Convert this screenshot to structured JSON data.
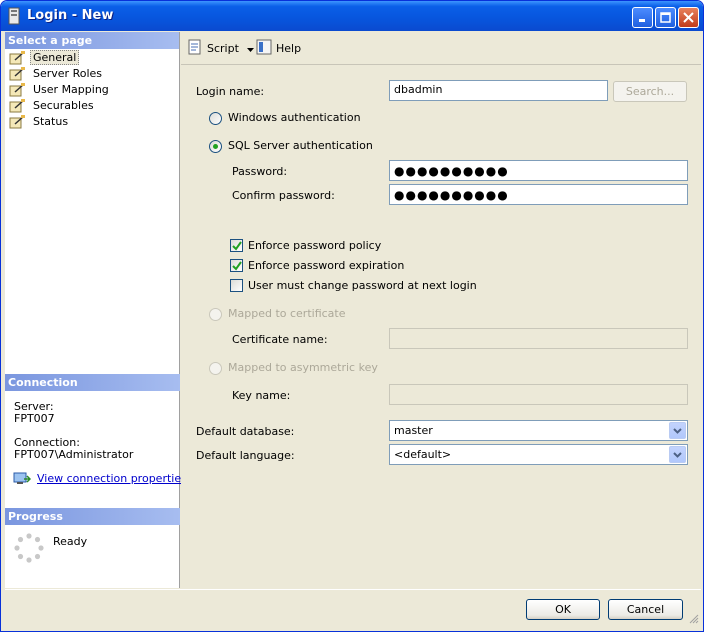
{
  "window": {
    "title": "Login - New"
  },
  "sidebar": {
    "select_page_header": "Select a page",
    "pages": [
      {
        "label": "General",
        "selected": true
      },
      {
        "label": "Server Roles",
        "selected": false
      },
      {
        "label": "User Mapping",
        "selected": false
      },
      {
        "label": "Securables",
        "selected": false
      },
      {
        "label": "Status",
        "selected": false
      }
    ],
    "connection_header": "Connection",
    "server_label": "Server:",
    "server_value": "FPT007",
    "connection_label": "Connection:",
    "connection_value": "FPT007\\Administrator",
    "view_connection_link": "View connection properties",
    "progress_header": "Progress",
    "progress_status": "Ready"
  },
  "toolbar": {
    "script_label": "Script",
    "help_label": "Help"
  },
  "form": {
    "login_name_label": "Login name:",
    "login_name_value": "dbadmin",
    "search_button": "Search...",
    "windows_auth_label": "Windows authentication",
    "sql_auth_label": "SQL Server authentication",
    "auth_mode_selected": "sql",
    "password_label": "Password:",
    "password_value": "●●●●●●●●●●",
    "confirm_password_label": "Confirm password:",
    "confirm_password_value": "●●●●●●●●●●",
    "enforce_policy_label": "Enforce password policy",
    "enforce_policy_checked": true,
    "enforce_expiration_label": "Enforce password expiration",
    "enforce_expiration_checked": true,
    "must_change_label": "User must change password at next login",
    "must_change_checked": false,
    "mapped_cert_label": "Mapped to certificate",
    "cert_name_label": "Certificate name:",
    "mapped_asym_label": "Mapped to asymmetric key",
    "key_name_label": "Key name:",
    "default_database_label": "Default database:",
    "default_database_value": "master",
    "default_language_label": "Default language:",
    "default_language_value": "<default>"
  },
  "footer": {
    "ok_label": "OK",
    "cancel_label": "Cancel"
  },
  "colors": {
    "title_bar": "#0855DD",
    "panel_header": "#7A96DF",
    "dialog_bg": "#ECE9D8",
    "link": "#0000CC"
  }
}
